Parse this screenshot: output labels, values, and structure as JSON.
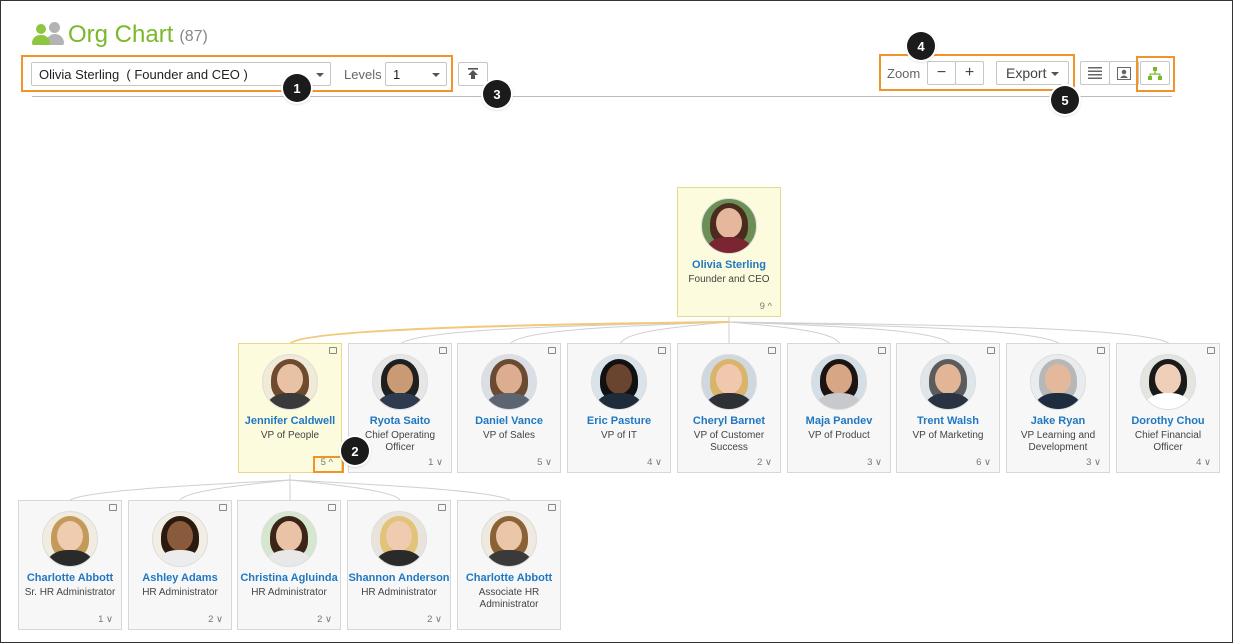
{
  "header": {
    "title": "Org Chart",
    "count": "(87)"
  },
  "controls": {
    "person_select": "Olivia Sterling  ( Founder and CEO )",
    "levels_label": "Levels",
    "levels_value": "1",
    "zoom_label": "Zoom",
    "zoom_out": "−",
    "zoom_in": "+",
    "export_label": "Export"
  },
  "callouts": [
    "1",
    "2",
    "3",
    "4",
    "5"
  ],
  "colors": {
    "brand_green": "#7ab829",
    "link_blue": "#1f78c1",
    "highlight_orange": "#f0932b",
    "selected_card": "#fdfbdd"
  },
  "root": {
    "name": "Olivia Sterling",
    "role": "Founder and CEO",
    "count": "9 ^"
  },
  "level1": [
    {
      "name": "Jennifer Caldwell",
      "role": "VP of People",
      "count": "5 ^"
    },
    {
      "name": "Ryota Saito",
      "role": "Chief Operating Officer",
      "count": "1 ∨"
    },
    {
      "name": "Daniel Vance",
      "role": "VP of Sales",
      "count": "5 ∨"
    },
    {
      "name": "Eric Pasture",
      "role": "VP of IT",
      "count": "4 ∨"
    },
    {
      "name": "Cheryl Barnet",
      "role": "VP of Customer Success",
      "count": "2 ∨"
    },
    {
      "name": "Maja Pandev",
      "role": "VP of Product",
      "count": "3 ∨"
    },
    {
      "name": "Trent Walsh",
      "role": "VP of Marketing",
      "count": "6 ∨"
    },
    {
      "name": "Jake Ryan",
      "role": "VP Learning and Development",
      "count": "3 ∨"
    },
    {
      "name": "Dorothy Chou",
      "role": "Chief Financial Officer",
      "count": "4 ∨"
    }
  ],
  "level2": [
    {
      "name": "Charlotte Abbott",
      "role": "Sr. HR Administrator",
      "count": "1 ∨"
    },
    {
      "name": "Ashley Adams",
      "role": "HR Administrator",
      "count": "2 ∨"
    },
    {
      "name": "Christina Agluinda",
      "role": "HR Administrator",
      "count": "2 ∨"
    },
    {
      "name": "Shannon Anderson",
      "role": "HR Administrator",
      "count": "2 ∨"
    },
    {
      "name": "Charlotte Abbott",
      "role": "Associate HR Administrator",
      "count": ""
    }
  ]
}
